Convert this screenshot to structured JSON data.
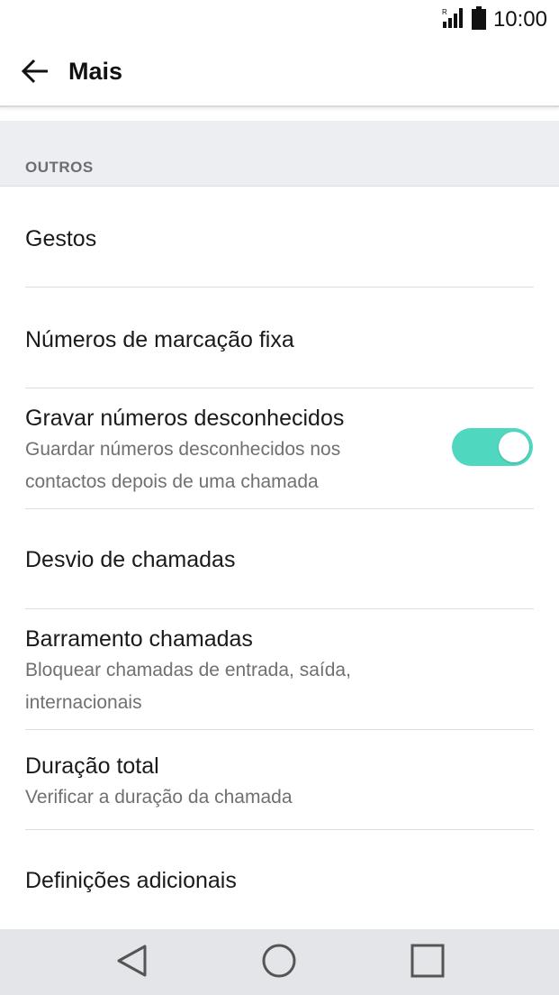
{
  "status_bar": {
    "signal_icon": "signal-roaming-icon",
    "battery_icon": "battery-full-icon",
    "time": "10:00"
  },
  "app_bar": {
    "back_icon": "arrow-back-icon",
    "title": "Mais"
  },
  "section": {
    "title": "OUTROS"
  },
  "items": [
    {
      "title": "Gestos"
    },
    {
      "title": "Números de marcação fixa"
    },
    {
      "title": "Gravar números desconhecidos",
      "subtitle": "Guardar números desconhecidos nos contactos depois de uma chamada",
      "toggle_on": true
    },
    {
      "title": "Desvio de chamadas"
    },
    {
      "title": "Barramento chamadas",
      "subtitle": "Bloquear chamadas de entrada, saída, internacionais"
    },
    {
      "title": "Duração total",
      "subtitle": "Verificar a duração da chamada"
    },
    {
      "title": "Definições adicionais"
    }
  ],
  "colors": {
    "toggle_on": "#4fd8bf",
    "section_bg": "#eceef1",
    "navbar_bg": "#e4e5e9"
  },
  "nav_bar": {
    "back_icon": "nav-back-triangle-icon",
    "home_icon": "nav-home-circle-icon",
    "recents_icon": "nav-recents-square-icon"
  }
}
